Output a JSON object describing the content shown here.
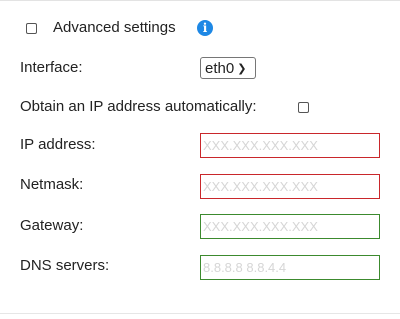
{
  "advanced": {
    "checkbox_checked": false,
    "label": "Advanced settings",
    "info_icon": "info-icon"
  },
  "interface": {
    "label": "Interface:",
    "selected": "eth0"
  },
  "dhcp": {
    "label": "Obtain an IP address automatically:",
    "checked": false
  },
  "fields": {
    "ip": {
      "label": "IP address:",
      "placeholder": "XXX.XXX.XXX.XXX",
      "status": "invalid"
    },
    "netmask": {
      "label": "Netmask:",
      "placeholder": "XXX.XXX.XXX.XXX",
      "status": "invalid"
    },
    "gateway": {
      "label": "Gateway:",
      "placeholder": "XXX.XXX.XXX.XXX",
      "status": "valid"
    },
    "dns": {
      "label": "DNS servers:",
      "placeholder": "8.8.8.8 8.8.4.4",
      "status": "valid"
    }
  },
  "colors": {
    "invalid": "#c9272b",
    "valid": "#3c8a2e",
    "info": "#1e88e5"
  }
}
